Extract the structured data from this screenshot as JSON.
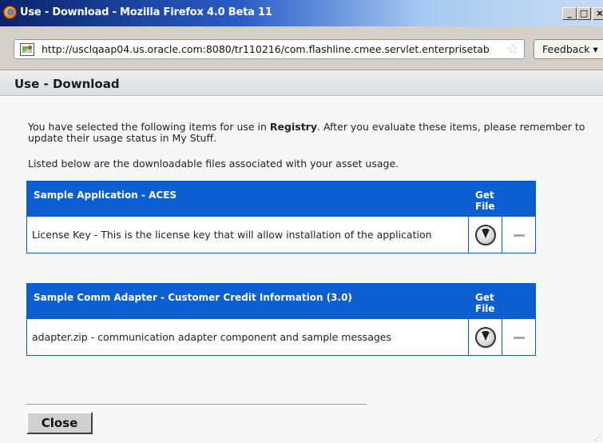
{
  "window": {
    "title": "Use - Download - Mozilla Firefox 4.0 Beta 11",
    "minimize_icon": "minimize-icon",
    "maximize_icon": "maximize-icon",
    "close_icon": "close-icon"
  },
  "addressbar": {
    "url": "http://usclqaap04.us.oracle.com:8080/tr110216/com.flashline.cmee.servlet.enterprisetab",
    "feedback_label": "Feedback",
    "feedback_arrow": "▾"
  },
  "page": {
    "title": "Use - Download",
    "intro_before": "You have selected the following items for use in ",
    "intro_bold": "Registry",
    "intro_after": ". After you evaluate these items, please remember to update their usage status in My Stuff.",
    "listed_text": "Listed below are the downloadable files associated with your asset usage."
  },
  "assets": [
    {
      "name": "Sample Application - ACES",
      "get_file_label": "Get File",
      "files": [
        {
          "description": "License Key - This is the license key that will allow installation of the application"
        }
      ]
    },
    {
      "name": "Sample Comm Adapter - Customer Credit Information (3.0)",
      "get_file_label": "Get File",
      "files": [
        {
          "description": "adapter.zip - communication adapter component and sample messages"
        }
      ]
    }
  ],
  "footer": {
    "close_label": "Close"
  },
  "colors": {
    "table_header": "#0b5fd2",
    "titlebar_start": "#0a246a"
  }
}
